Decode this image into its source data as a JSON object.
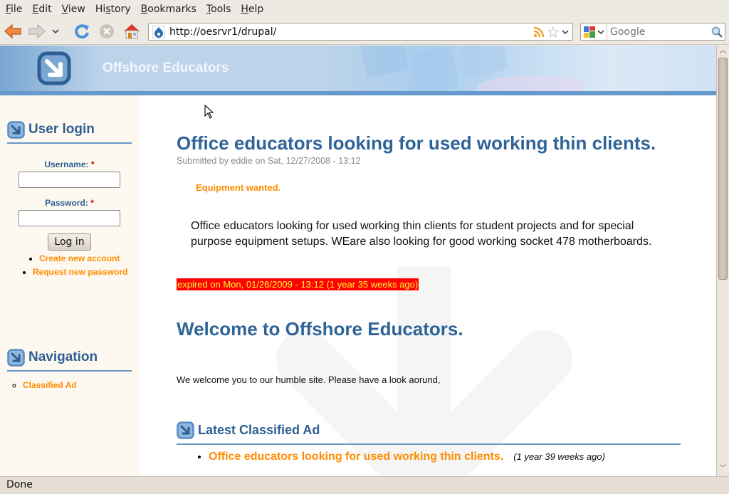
{
  "browser": {
    "menu": [
      {
        "label": "File",
        "accel": "F",
        "rest": "ile"
      },
      {
        "label": "Edit",
        "accel": "E",
        "rest": "dit"
      },
      {
        "label": "View",
        "accel": "V",
        "rest": "iew"
      },
      {
        "label": "History",
        "pre": "Hi",
        "accel": "s",
        "rest": "tory"
      },
      {
        "label": "Bookmarks",
        "accel": "B",
        "rest": "ookmarks"
      },
      {
        "label": "Tools",
        "accel": "T",
        "rest": "ools"
      },
      {
        "label": "Help",
        "accel": "H",
        "rest": "elp"
      }
    ],
    "url": "http://oesrvr1/drupal/",
    "search_placeholder": "Google",
    "status": "Done"
  },
  "site": {
    "name": "Offshore Educators",
    "colors": {
      "title_blue": "#2f6497",
      "link_orange": "#ff8c00",
      "accent_stripe": "#6699cc",
      "expired_bg": "#ff0000",
      "expired_fg": "#ffff33"
    }
  },
  "sidebar": {
    "login": {
      "title": "User login",
      "username_label": "Username:",
      "password_label": "Password:",
      "required_mark": "*",
      "username_value": "",
      "password_value": "",
      "submit_label": "Log in",
      "links": [
        "Create new account",
        "Request new password"
      ]
    },
    "navigation": {
      "title": "Navigation",
      "links": [
        "Classified Ad"
      ]
    }
  },
  "main": {
    "node": {
      "title": "Office educators looking for used working thin clients.",
      "submitted": "Submitted by eddie on Sat, 12/27/2008 - 13:12",
      "taxonomy": "Equipment wanted.",
      "body": "Office educators looking for used working thin clients for student projects and for special purpose equipment setups. WEare also looking for good working socket 478 motherboards.",
      "expired": "expired on Mon, 01/26/2009 - 13:12 (1 year 35 weeks ago)"
    },
    "welcome": {
      "title": "Welcome to Offshore Educators.",
      "text": "We welcome you to our humble site. Please have a look aorund,"
    },
    "latest": {
      "title": "Latest Classified Ad",
      "items": [
        {
          "title": "Office educators looking for used working thin clients.",
          "ago": "(1 year 39 weeks ago)"
        }
      ]
    }
  }
}
